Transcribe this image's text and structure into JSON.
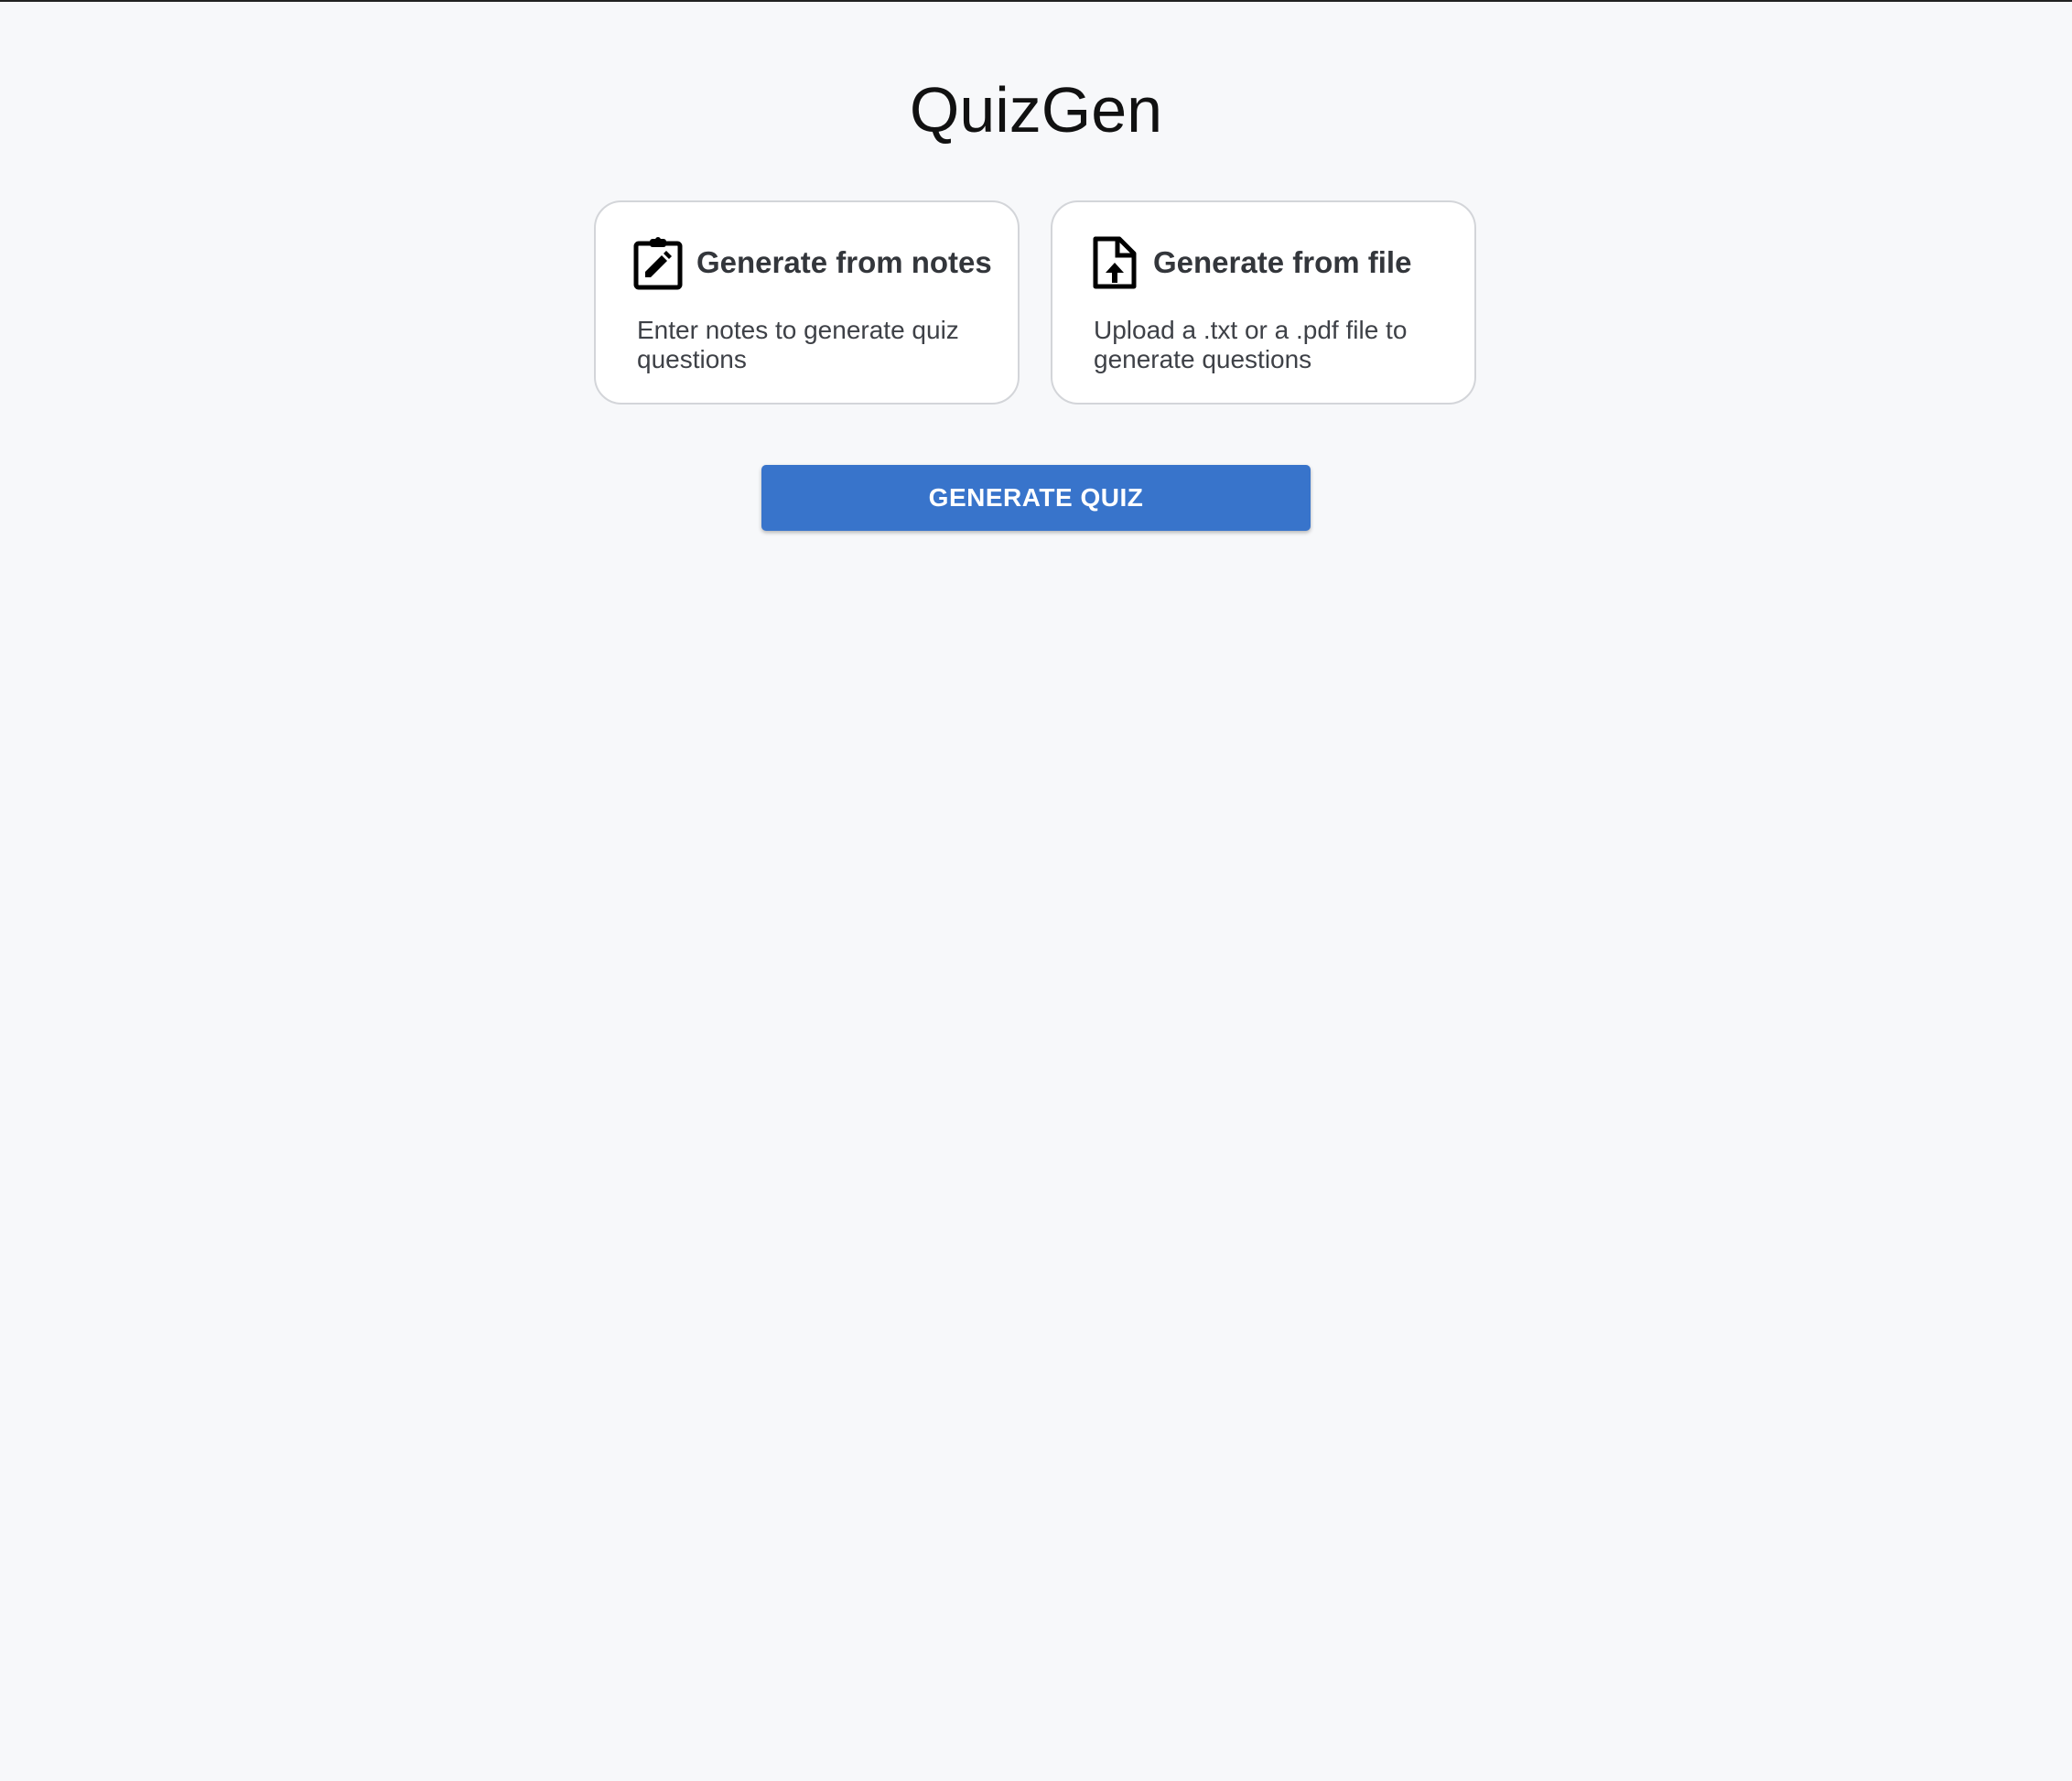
{
  "app": {
    "title": "QuizGen"
  },
  "options": [
    {
      "icon": "clipboard-edit-icon",
      "title": "Generate from notes",
      "description": "Enter notes to generate quiz questions"
    },
    {
      "icon": "file-upload-icon",
      "title": "Generate from file",
      "description": "Upload a .txt or a .pdf file to generate questions"
    }
  ],
  "actions": {
    "generate_label": "GENERATE QUIZ"
  },
  "colors": {
    "background": "#f7f8fa",
    "card_background": "#ffffff",
    "card_border": "#d3d5d9",
    "primary_button": "#3874cb",
    "title_text": "#111111",
    "card_title_text": "#33363b"
  }
}
